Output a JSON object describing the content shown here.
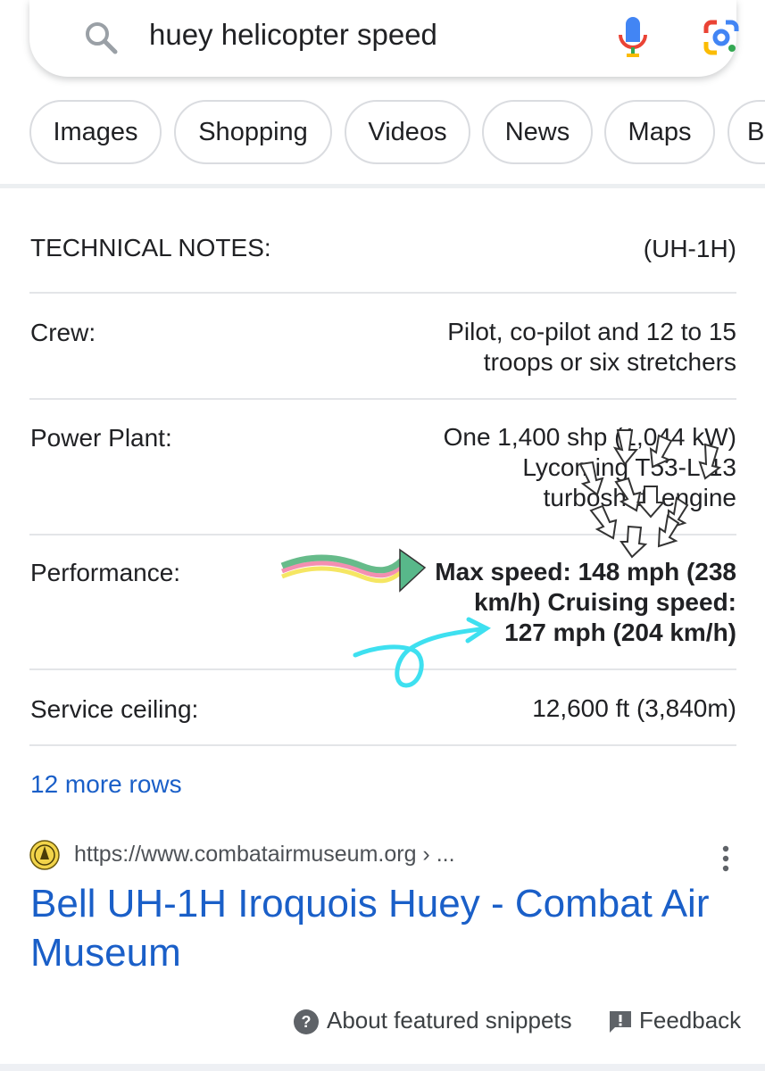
{
  "search": {
    "query": "huey helicopter speed"
  },
  "chips": [
    "Images",
    "Shopping",
    "Videos",
    "News",
    "Maps",
    "B"
  ],
  "table": {
    "header_label": "TECHNICAL NOTES:",
    "header_value": "(UH-1H)",
    "rows": [
      {
        "label": "Crew:",
        "value_lines": [
          "Pilot, co-pilot and 12 to 15",
          "troops or six stretchers"
        ]
      },
      {
        "label": "Power Plant:",
        "value_lines": [
          "One 1,400 shp (1,044 kW)",
          "Lycoming T53-L-13",
          "turboshaft engine"
        ]
      },
      {
        "label": "Performance:",
        "value_lines": [
          "Max speed: 148 mph (238",
          "km/h) Cruising speed:",
          "127 mph (204 km/h)"
        ]
      },
      {
        "label": "Service ceiling:",
        "value_lines": [
          "12,600 ft (3,840m)"
        ]
      }
    ],
    "more_rows": "12 more rows"
  },
  "result": {
    "url": "https://www.combatairmuseum.org › ...",
    "title": "Bell UH-1H Iroquois Huey - Combat Air Museum"
  },
  "footer": {
    "about": "About featured snippets",
    "feedback": "Feedback"
  },
  "colors": {
    "link": "#1a5fc8",
    "annotation_arrow": "#3ee0f0",
    "rainbow_arrow_tip": "#58b88a"
  }
}
